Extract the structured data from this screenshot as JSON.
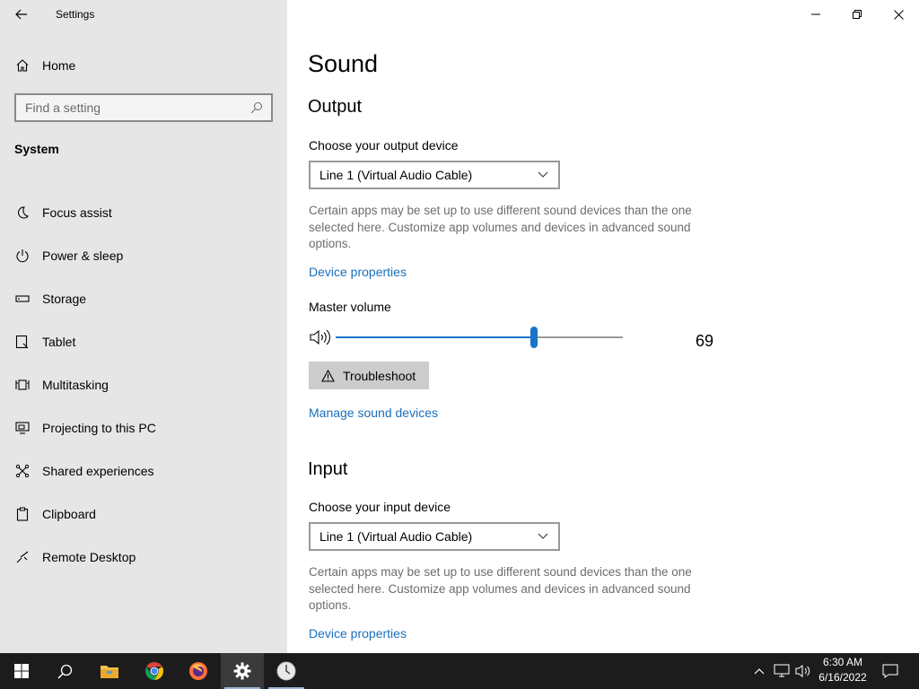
{
  "window": {
    "app_title": "Settings"
  },
  "sidebar": {
    "home_label": "Home",
    "search_placeholder": "Find a setting",
    "section_heading": "System",
    "items": [
      {
        "label": "Focus assist",
        "icon": "moon-icon"
      },
      {
        "label": "Power & sleep",
        "icon": "power-icon"
      },
      {
        "label": "Storage",
        "icon": "storage-icon"
      },
      {
        "label": "Tablet",
        "icon": "tablet-icon"
      },
      {
        "label": "Multitasking",
        "icon": "multitasking-icon"
      },
      {
        "label": "Projecting to this PC",
        "icon": "projecting-icon"
      },
      {
        "label": "Shared experiences",
        "icon": "shared-experiences-icon"
      },
      {
        "label": "Clipboard",
        "icon": "clipboard-icon"
      },
      {
        "label": "Remote Desktop",
        "icon": "remote-desktop-icon"
      }
    ]
  },
  "main": {
    "title": "Sound",
    "output": {
      "heading": "Output",
      "device_label": "Choose your output device",
      "device_value": "Line 1 (Virtual Audio Cable)",
      "description": "Certain apps may be set up to use different sound devices than the one selected here. Customize app volumes and devices in advanced sound options.",
      "device_properties_link": "Device properties",
      "master_volume_label": "Master volume",
      "volume_value": "69",
      "volume_level": 0.69,
      "troubleshoot_label": "Troubleshoot",
      "manage_devices_link": "Manage sound devices"
    },
    "input": {
      "heading": "Input",
      "device_label": "Choose your input device",
      "device_value": "Line 1 (Virtual Audio Cable)",
      "description": "Certain apps may be set up to use different sound devices than the one selected here. Customize app volumes and devices in advanced sound options.",
      "device_properties_link": "Device properties"
    }
  },
  "taskbar": {
    "time": "6:30 AM",
    "date": "6/16/2022",
    "apps": [
      "windows-start",
      "search",
      "file-explorer",
      "chrome",
      "firefox",
      "settings",
      "clock-app"
    ]
  },
  "colors": {
    "accent": "#1a73c7",
    "link": "#1a6fbd",
    "sidebar_bg": "#e6e6e6",
    "taskbar_bg": "#1c1c1c"
  }
}
